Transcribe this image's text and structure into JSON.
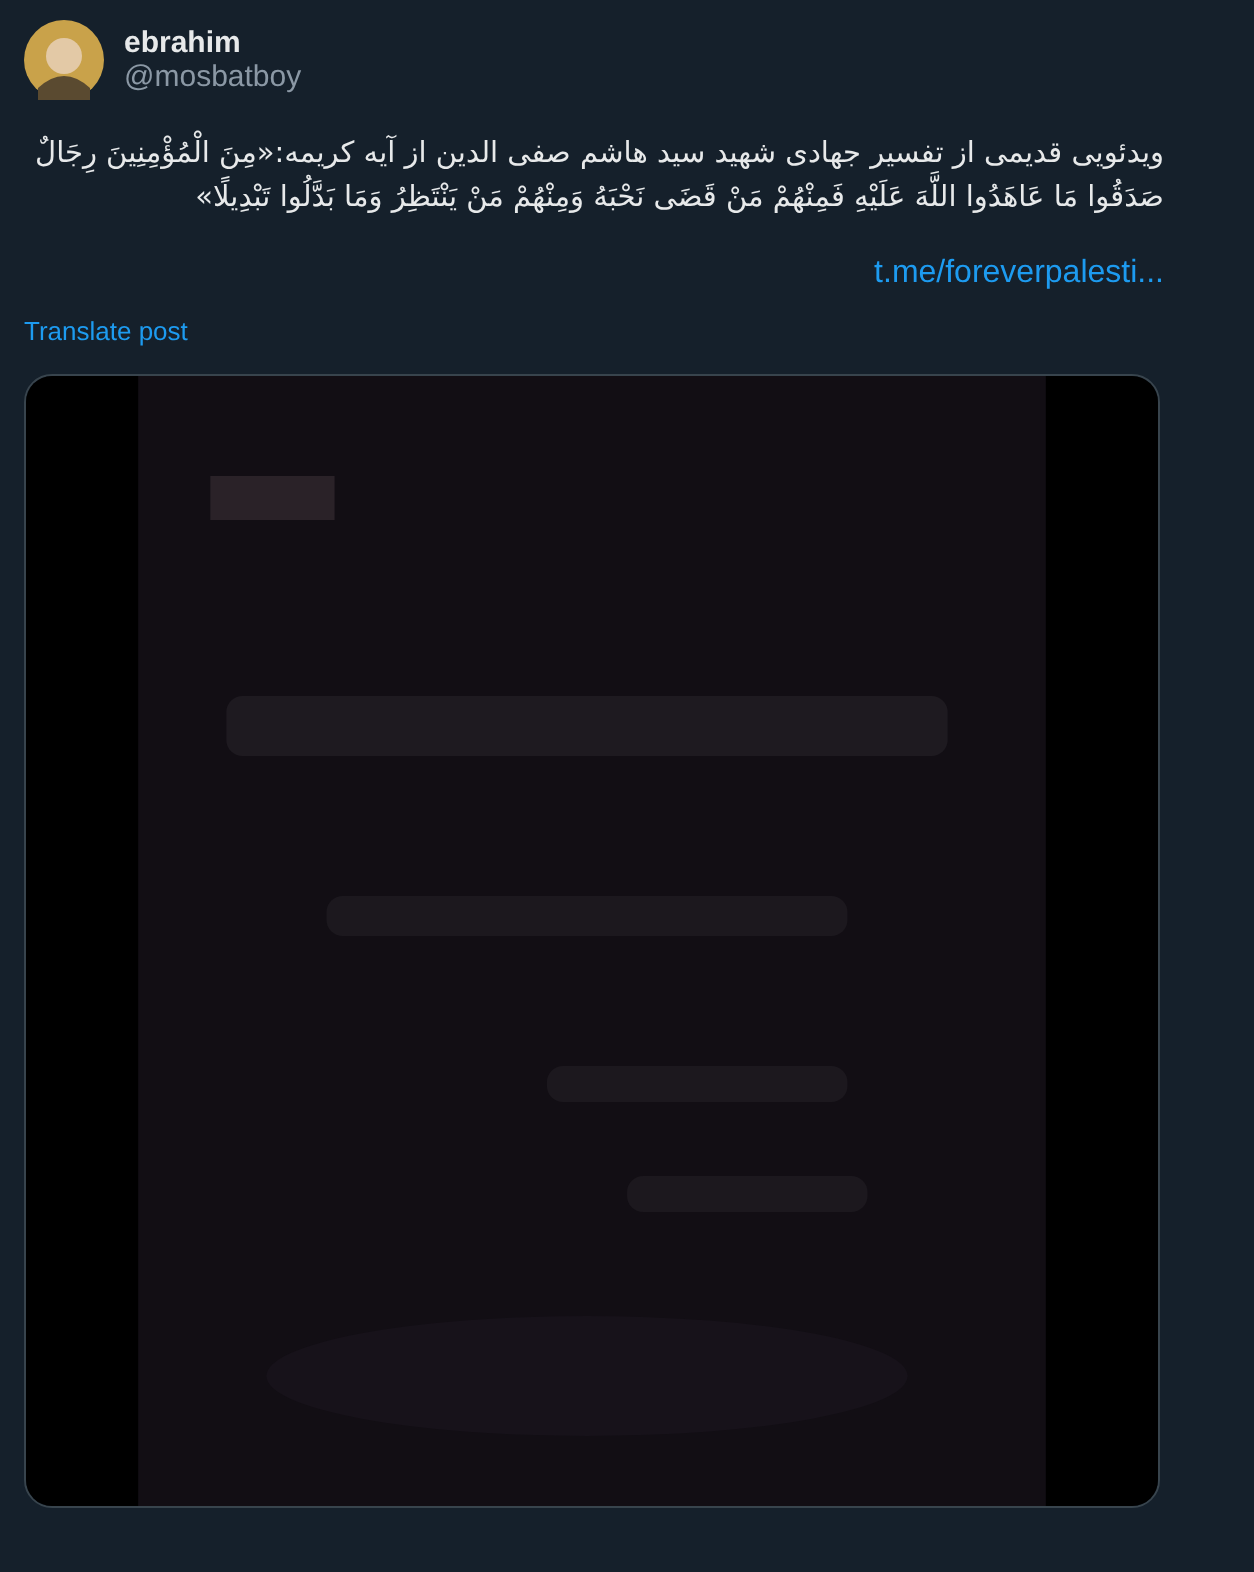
{
  "author": {
    "name": "ebrahim",
    "handle": "@mosbatboy"
  },
  "post": {
    "text": "ویدئویی قدیمی از تفسیر جهادی شهید سید هاشم صفی الدین از آیه کریمه:«مِنَ الْمُؤْمِنِينَ رِجَالٌ صَدَقُوا مَا عَاهَدُوا اللَّهَ عَلَيْهِ فَمِنْهُمْ مَنْ قَضَى نَحْبَهُ وَمِنْهُمْ مَنْ يَنْتَظِرُ وَمَا بَدَّلُوا تَبْدِيلًا»",
    "link": "t.me/foreverpalesti...",
    "translate": "Translate post"
  }
}
